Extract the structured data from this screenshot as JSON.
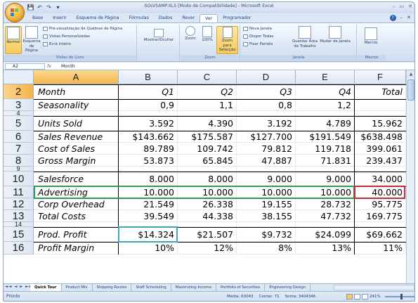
{
  "window": {
    "title": "SOLVSAMP.XLS [Modo de Compatibilidade] - Microsoft Excel",
    "controls": [
      "–",
      "▭",
      "✕"
    ]
  },
  "quick_access": [
    "💾",
    "↶",
    "↷",
    "▾"
  ],
  "tabs": [
    "Base",
    "Inserir",
    "Esquema de Página",
    "Fórmulas",
    "Dados",
    "Rever",
    "Ver",
    "Programador"
  ],
  "active_tab": "Ver",
  "ribbon_controls": [
    "–",
    "✕"
  ],
  "ribbon": {
    "vistas": {
      "label": "Vistas de Livro",
      "normal": "Normal",
      "esquema": "Esquema de Página",
      "preview": "Pré-visualização de Quebras de Página",
      "personalizadas": "Vistas Personalizadas",
      "ecra": "Ecrã Inteiro"
    },
    "mostrar": {
      "label": "Mostrar/Ocultar"
    },
    "zoom": {
      "label": "Zoom",
      "zoom": "Zoom",
      "z100": "100%",
      "selecao": "Zoom para Selecção"
    },
    "janela": {
      "label": "Janela",
      "nova": "Nova Janela",
      "dispor": "Dispor Todas",
      "fixar": "Fixar Painéis",
      "guardar": "Guardar Área de Trabalho",
      "mudar": "Mudar de Janela"
    },
    "macros": {
      "label": "Macros",
      "macros": "Macros"
    }
  },
  "formula_bar": {
    "cell": "A2",
    "fx": "fx",
    "content": "Month"
  },
  "columns": [
    "A",
    "B",
    "C",
    "D",
    "E",
    "F"
  ],
  "rows": [
    {
      "num": "2",
      "cells": [
        "Month",
        "Q1",
        "Q2",
        "Q3",
        "Q4",
        "Total"
      ]
    },
    {
      "num": "3",
      "cells": [
        "Seasonality",
        "0,9",
        "1,1",
        "0,8",
        "1,2",
        ""
      ]
    },
    {
      "num": "4",
      "cells": [
        "",
        "",
        "",
        "",
        "",
        ""
      ]
    },
    {
      "num": "5",
      "cells": [
        "Units Sold",
        "3.592",
        "4.390",
        "3.192",
        "4.789",
        "15.962"
      ]
    },
    {
      "num": "6",
      "cells": [
        "Sales Revenue",
        "$143.662",
        "$175.587",
        "$127.700",
        "$191.549",
        "$638.498"
      ]
    },
    {
      "num": "7",
      "cells": [
        "Cost of Sales",
        "89.789",
        "109.742",
        "79.812",
        "119.718",
        "399.061"
      ]
    },
    {
      "num": "8",
      "cells": [
        "Gross Margin",
        "53.873",
        "65.845",
        "47.887",
        "71.831",
        "239.437"
      ]
    },
    {
      "num": "9",
      "cells": [
        "",
        "",
        "",
        "",
        "",
        ""
      ]
    },
    {
      "num": "10",
      "cells": [
        "Salesforce",
        "8.000",
        "8.000",
        "9.000",
        "9.000",
        "34.000"
      ]
    },
    {
      "num": "11",
      "cells": [
        "Advertising",
        "10.000",
        "10.000",
        "10.000",
        "10.000",
        "40.000"
      ]
    },
    {
      "num": "12",
      "cells": [
        "Corp Overhead",
        "21.549",
        "26.338",
        "19.155",
        "28.732",
        "95.775"
      ]
    },
    {
      "num": "13",
      "cells": [
        "Total Costs",
        "39.549",
        "44.338",
        "38.155",
        "47.732",
        "169.775"
      ]
    },
    {
      "num": "14",
      "cells": [
        "",
        "",
        "",
        "",
        "",
        ""
      ]
    },
    {
      "num": "15",
      "cells": [
        "Prod. Profit",
        "$14.324",
        "$21.507",
        "$9.732",
        "$24.099",
        "$69.662"
      ]
    },
    {
      "num": "16",
      "cells": [
        "Profit Margin",
        "10%",
        "12%",
        "8%",
        "13%",
        "11%"
      ]
    }
  ],
  "sheets": [
    "Quick Tour",
    "Product Mix",
    "Shipping Routes",
    "Staff Scheduling",
    "Maximizing Income",
    "Portfolio of Securities",
    "Engineering Design"
  ],
  "active_sheet": "Quick Tour",
  "sheet_nav": "◄◄ ◄ ► ►►",
  "status": {
    "ready": "Pronto",
    "media": "Média: 63043",
    "contar": "Contar: 71",
    "soma": "Soma: 3404346",
    "zoom": "241%"
  },
  "colors": {
    "ribbon_bg": "#dde8f6",
    "selected_header": "#f7b24a",
    "advertising_border": "#2e9a52",
    "f11_border": "#c0303c",
    "profit_border": "#3fa7b8"
  }
}
